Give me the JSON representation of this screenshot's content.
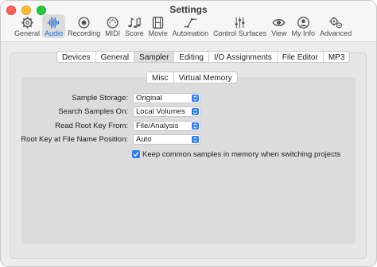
{
  "window": {
    "title": "Settings"
  },
  "toolbar": {
    "items": [
      {
        "label": "General",
        "icon": "gear-icon"
      },
      {
        "label": "Audio",
        "icon": "waveform-icon",
        "active": true
      },
      {
        "label": "Recording",
        "icon": "record-icon"
      },
      {
        "label": "MIDI",
        "icon": "midi-icon"
      },
      {
        "label": "Score",
        "icon": "music-notes-icon"
      },
      {
        "label": "Movie",
        "icon": "film-icon"
      },
      {
        "label": "Automation",
        "icon": "automation-curve-icon"
      },
      {
        "label": "Control Surfaces",
        "icon": "sliders-icon"
      },
      {
        "label": "View",
        "icon": "eye-icon"
      },
      {
        "label": "My Info",
        "icon": "person-icon"
      },
      {
        "label": "Advanced",
        "icon": "gears-icon"
      }
    ]
  },
  "tabs": [
    "Devices",
    "General",
    "Sampler",
    "Editing",
    "I/O Assignments",
    "File Editor",
    "MP3"
  ],
  "active_tab": "Sampler",
  "subtabs": [
    "Misc",
    "Virtual Memory"
  ],
  "active_subtab": "Misc",
  "form": {
    "sample_storage": {
      "label": "Sample Storage:",
      "value": "Original"
    },
    "search_samples_on": {
      "label": "Search Samples On:",
      "value": "Local Volumes"
    },
    "read_root_key_from": {
      "label": "Read Root Key From:",
      "value": "File/Analysis"
    },
    "root_key_position": {
      "label": "Root Key at File Name Position:",
      "value": "Auto"
    },
    "keep_common_samples": {
      "label": "Keep common samples in memory when switching projects",
      "checked": true
    }
  },
  "colors": {
    "accent": "#2f7cf6",
    "active_label": "#1f6fe0"
  }
}
